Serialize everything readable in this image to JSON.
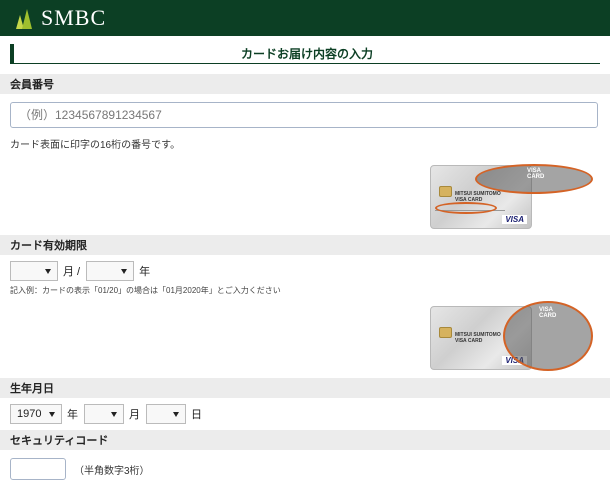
{
  "header": {
    "brand": "SMBC"
  },
  "page": {
    "title": "カードお届け内容の入力"
  },
  "member_number": {
    "label": "会員番号",
    "placeholder": "（例）1234567891234567",
    "hint": "カード表面に印字の16桁の番号です。"
  },
  "card_image": {
    "issuer_lines": [
      "MITSUI SUMITOMO",
      "VISA CARD"
    ],
    "network": "VISA",
    "callout_label": "VISA CARD"
  },
  "expiry": {
    "label": "カード有効期限",
    "month_unit": "月 /",
    "year_unit": "年",
    "month_value": "",
    "year_value": "",
    "example": "記入例：カードの表示「01/20」の場合は「01月2020年」とご入力ください"
  },
  "birthdate": {
    "label": "生年月日",
    "year_value": "1970",
    "year_unit": "年",
    "month_value": "",
    "month_unit": "月",
    "day_value": "",
    "day_unit": "日"
  },
  "security_code": {
    "label": "セキュリティコード",
    "note": "（半角数字3桁）"
  },
  "colors": {
    "brand_green": "#0c3f24",
    "highlight": "#d46326",
    "section_bg": "#ececec"
  }
}
